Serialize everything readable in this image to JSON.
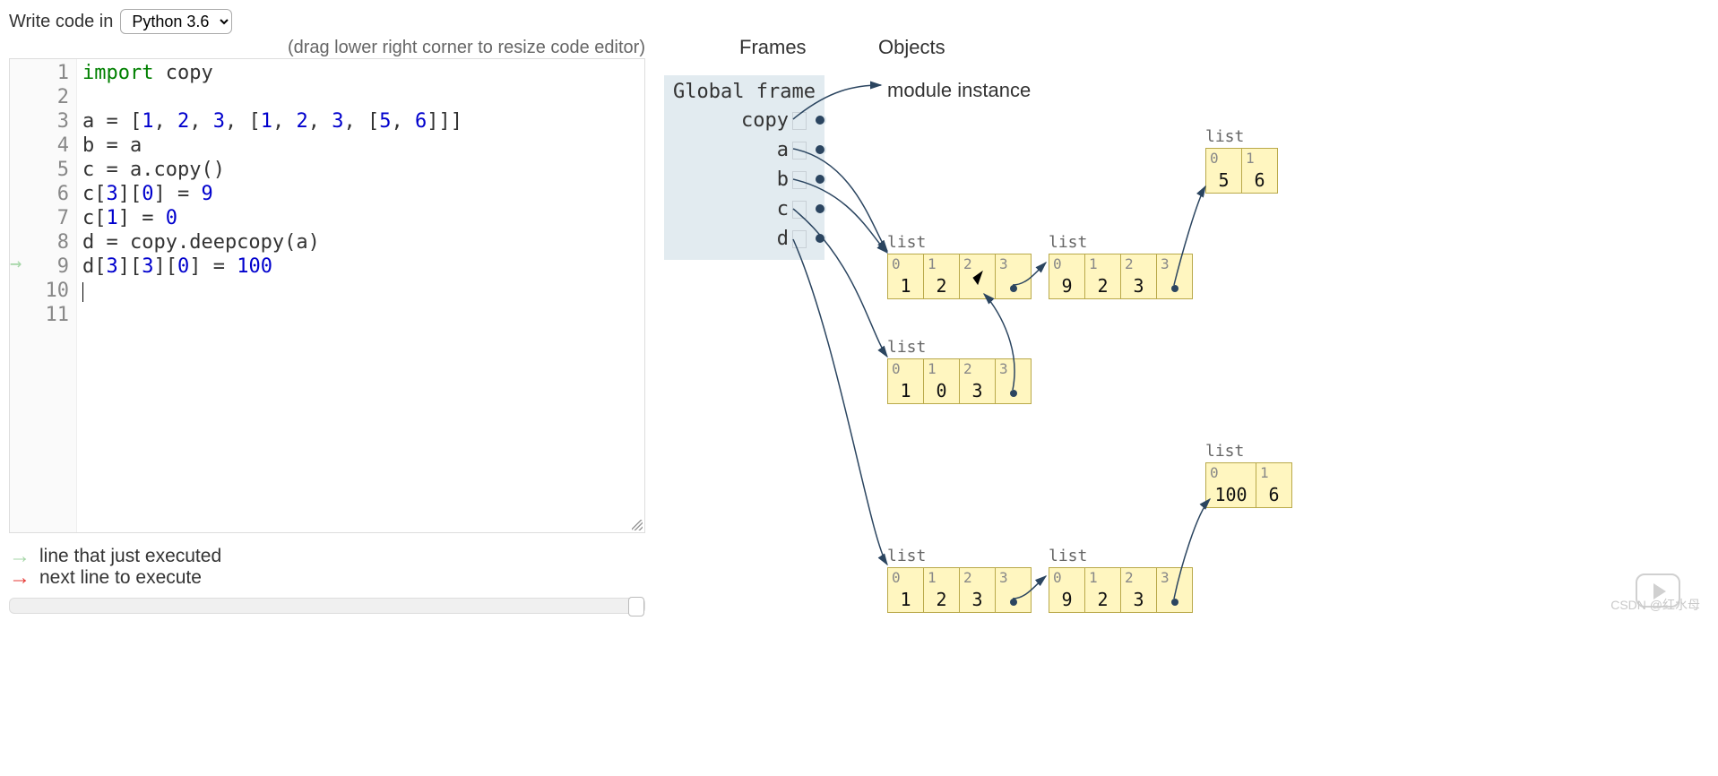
{
  "topbar": {
    "write_label": "Write code in",
    "language": "Python 3.6"
  },
  "hint": "(drag lower right corner to resize code editor)",
  "code": {
    "lines": [
      {
        "n": 1,
        "tokens": [
          [
            "kw",
            "import"
          ],
          [
            "",
            " copy"
          ]
        ]
      },
      {
        "n": 2,
        "tokens": []
      },
      {
        "n": 3,
        "tokens": [
          [
            "",
            "a = ["
          ],
          [
            "num",
            "1"
          ],
          [
            "",
            ", "
          ],
          [
            "num",
            "2"
          ],
          [
            "",
            ", "
          ],
          [
            "num",
            "3"
          ],
          [
            "",
            ", ["
          ],
          [
            "num",
            "1"
          ],
          [
            "",
            ", "
          ],
          [
            "num",
            "2"
          ],
          [
            "",
            ", "
          ],
          [
            "num",
            "3"
          ],
          [
            "",
            ", ["
          ],
          [
            "num",
            "5"
          ],
          [
            "",
            ", "
          ],
          [
            "num",
            "6"
          ],
          [
            "",
            "]]]"
          ]
        ]
      },
      {
        "n": 4,
        "tokens": [
          [
            "",
            "b = a"
          ]
        ]
      },
      {
        "n": 5,
        "tokens": [
          [
            "",
            "c = a.copy()"
          ]
        ]
      },
      {
        "n": 6,
        "tokens": [
          [
            "",
            "c["
          ],
          [
            "num",
            "3"
          ],
          [
            "",
            "]["
          ],
          [
            "num",
            "0"
          ],
          [
            "",
            "] = "
          ],
          [
            "num",
            "9"
          ]
        ]
      },
      {
        "n": 7,
        "tokens": [
          [
            "",
            "c["
          ],
          [
            "num",
            "1"
          ],
          [
            "",
            "] = "
          ],
          [
            "num",
            "0"
          ]
        ]
      },
      {
        "n": 8,
        "tokens": [
          [
            "",
            "d = copy.deepcopy(a)"
          ]
        ]
      },
      {
        "n": 9,
        "tokens": [
          [
            "",
            "d["
          ],
          [
            "num",
            "3"
          ],
          [
            "",
            "]["
          ],
          [
            "num",
            "3"
          ],
          [
            "",
            "]["
          ],
          [
            "num",
            "0"
          ],
          [
            "",
            "] = "
          ],
          [
            "num",
            "100"
          ]
        ]
      },
      {
        "n": 10,
        "tokens": [],
        "cursor": true
      },
      {
        "n": 11,
        "tokens": []
      }
    ],
    "last_executed_line": 9
  },
  "legend": {
    "executed": "line that just executed",
    "next": "next line to execute"
  },
  "viz": {
    "frames_hdr": "Frames",
    "objects_hdr": "Objects",
    "module_label": "module instance",
    "global_frame": {
      "title": "Global frame",
      "vars": [
        "copy",
        "a",
        "b",
        "c",
        "d"
      ]
    },
    "objects": {
      "list_a": {
        "label": "list",
        "indices": [
          "0",
          "1",
          "2",
          "3"
        ],
        "values": [
          "1",
          "2",
          "",
          "•"
        ]
      },
      "list_inner1": {
        "label": "list",
        "indices": [
          "0",
          "1",
          "2",
          "3"
        ],
        "values": [
          "9",
          "2",
          "3",
          "•"
        ]
      },
      "list_56": {
        "label": "list",
        "indices": [
          "0",
          "1"
        ],
        "values": [
          "5",
          "6"
        ]
      },
      "list_c": {
        "label": "list",
        "indices": [
          "0",
          "1",
          "2",
          "3"
        ],
        "values": [
          "1",
          "0",
          "3",
          "•"
        ]
      },
      "list_d": {
        "label": "list",
        "indices": [
          "0",
          "1",
          "2",
          "3"
        ],
        "values": [
          "1",
          "2",
          "3",
          "•"
        ]
      },
      "list_d_inner": {
        "label": "list",
        "indices": [
          "0",
          "1",
          "2",
          "3"
        ],
        "values": [
          "9",
          "2",
          "3",
          "•"
        ]
      },
      "list_100_6": {
        "label": "list",
        "indices": [
          "0",
          "1"
        ],
        "values": [
          "100",
          "6"
        ]
      }
    }
  },
  "watermark": "CSDN @红水母"
}
